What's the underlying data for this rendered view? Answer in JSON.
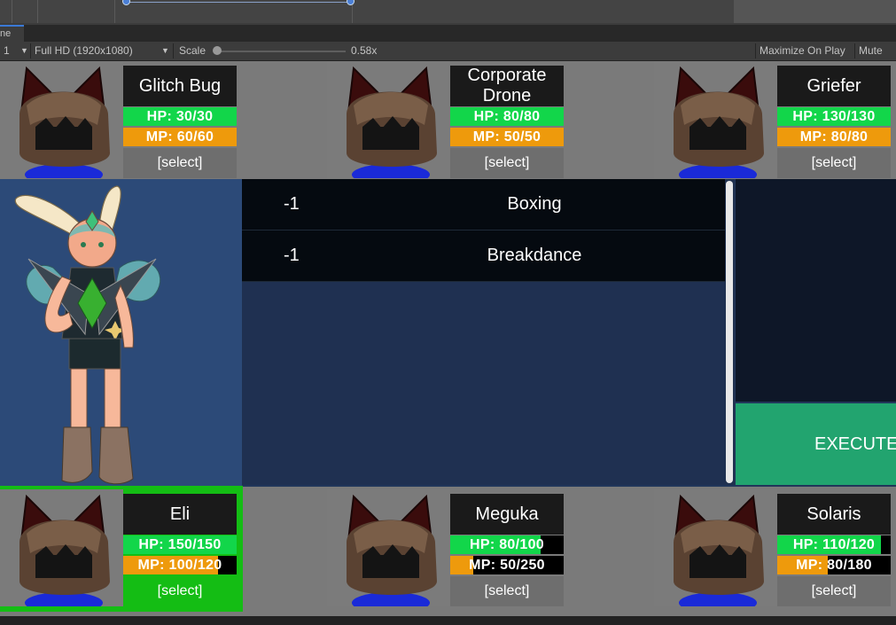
{
  "editor": {
    "tab_label": "ne",
    "display_value": "1",
    "resolution": "Full HD (1920x1080)",
    "scale_label": "Scale",
    "scale_value": "0.58x",
    "maximize_label": "Maximize On Play",
    "mute_label": "Mute Au"
  },
  "enemies": [
    {
      "name": "Glitch Bug",
      "hp_text": "HP: 30/30",
      "hp": 1.0,
      "mp_text": "MP: 60/60",
      "mp": 1.0,
      "select": "[select]"
    },
    {
      "name": "Corporate Drone",
      "hp_text": "HP: 80/80",
      "hp": 1.0,
      "mp_text": "MP: 50/50",
      "mp": 1.0,
      "select": "[select]"
    },
    {
      "name": "Griefer",
      "hp_text": "HP: 130/130",
      "hp": 1.0,
      "mp_text": "MP: 80/80",
      "mp": 1.0,
      "select": "[select]"
    }
  ],
  "party": [
    {
      "name": "Eli",
      "hp_text": "HP: 150/150",
      "hp": 1.0,
      "mp_text": "MP: 100/120",
      "mp": 0.8333,
      "select": "[select]",
      "active": true
    },
    {
      "name": "Meguka",
      "hp_text": "HP: 80/100",
      "hp": 0.8,
      "mp_text": "MP: 50/250",
      "mp": 0.2,
      "select": "[select]",
      "active": false
    },
    {
      "name": "Solaris",
      "hp_text": "HP: 110/120",
      "hp": 0.9167,
      "mp_text": "MP: 80/180",
      "mp": 0.4444,
      "select": "[select]",
      "active": false
    }
  ],
  "skills": [
    {
      "cost": "-1",
      "name": "Boxing"
    },
    {
      "cost": "-1",
      "name": "Breakdance"
    }
  ],
  "execute_label": "EXECUTE",
  "colors": {
    "hp": "#12d64a",
    "mp": "#ee9a0c",
    "active": "#14bd14",
    "execute": "#22a46f"
  }
}
